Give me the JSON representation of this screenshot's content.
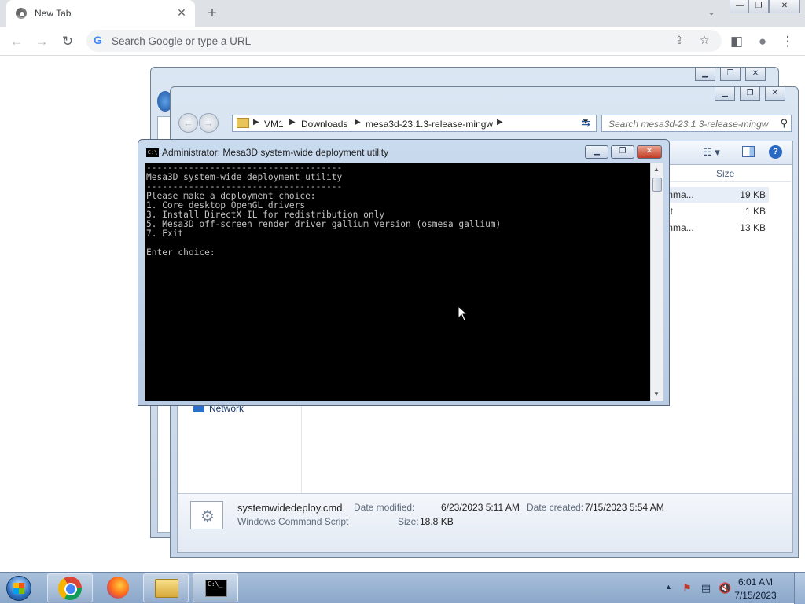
{
  "browser": {
    "tab_title": "New Tab",
    "tab_close": "✕",
    "new_tab": "+",
    "tab_dropdown": "⌄",
    "window_controls": {
      "minimize": "—",
      "restore": "❐",
      "close": "✕"
    },
    "nav": {
      "back": "←",
      "forward": "→",
      "reload": "↻"
    },
    "omnibox_placeholder": "Search Google or type a URL",
    "omnibox_g": "G",
    "share_icon": "⇪",
    "star_icon": "☆",
    "sidepanel_icon": "◧",
    "profile_icon": "●",
    "menu_icon": "⋮"
  },
  "explorer": {
    "breadcrumb": [
      "VM1",
      "Downloads",
      "mesa3d-23.1.3-release-mingw"
    ],
    "search_placeholder": "Search mesa3d-23.1.3-release-mingw",
    "column_size": "Size",
    "files": [
      {
        "name": "mma...",
        "size": "19 KB"
      },
      {
        "name": "nt",
        "size": "1 KB"
      },
      {
        "name": "mma...",
        "size": "13 KB"
      }
    ],
    "nav_network": "Network",
    "details": {
      "filename": "systemwidedeploy.cmd",
      "filetype": "Windows Command Script",
      "modified_label": "Date modified:",
      "modified_value": "6/23/2023 5:11 AM",
      "created_label": "Date created:",
      "created_value": "7/15/2023 5:54 AM",
      "size_label": "Size:",
      "size_value": "18.8 KB"
    }
  },
  "cmd": {
    "title": "Administrator:  Mesa3D system-wide deployment utility",
    "icon_text": "C:\\",
    "console_text": "-------------------------------------\nMesa3D system-wide deployment utility\n-------------------------------------\nPlease make a deployment choice:\n1. Core desktop OpenGL drivers\n3. Install DirectX IL for redistribution only\n5. Mesa3D off-screen render driver gallium version (osmesa gallium)\n7. Exit\n\nEnter choice:"
  },
  "taskbar": {
    "time": "6:01 AM",
    "date": "7/15/2023",
    "cmd_icon_text": "C:\\_"
  }
}
